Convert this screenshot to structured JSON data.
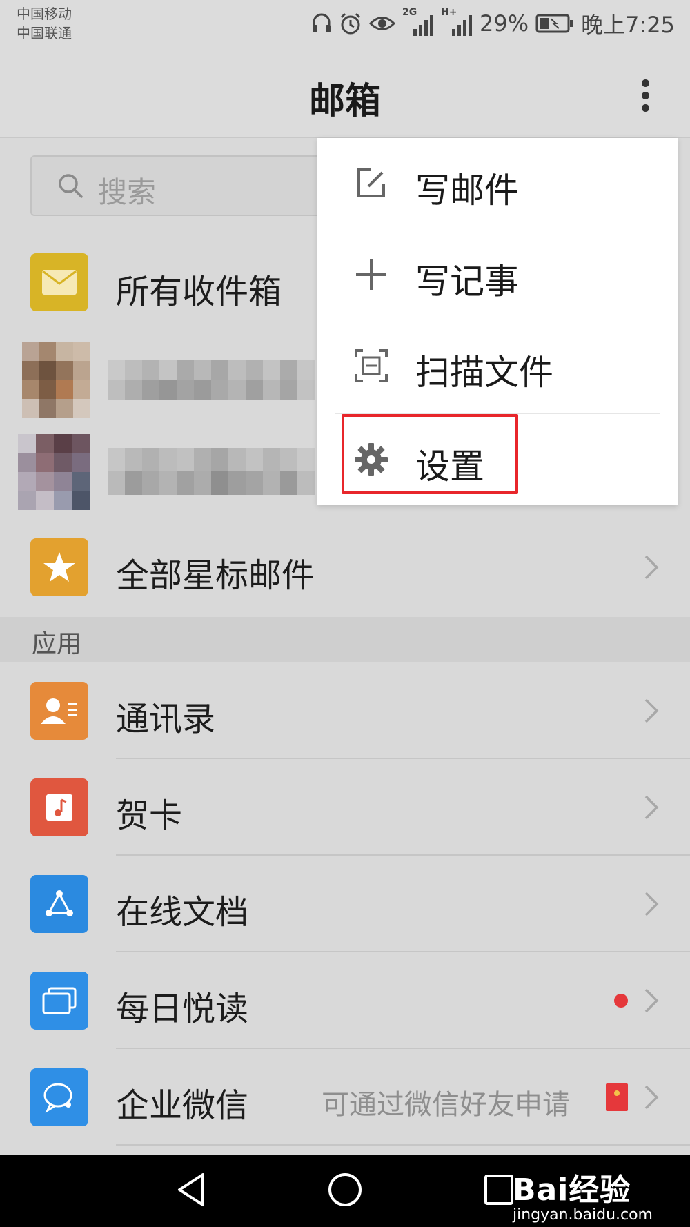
{
  "status_bar": {
    "carrier_1": "中国移动",
    "carrier_2": "中国联通",
    "signal_1": "2G",
    "signal_2": "H+",
    "battery": "29%",
    "time": "晚上7:25"
  },
  "header": {
    "title": "邮箱",
    "more_icon": "more-vertical-icon"
  },
  "search": {
    "placeholder": "搜索",
    "icon": "search-icon"
  },
  "mail_folders": [
    {
      "label": "所有收件箱",
      "icon": "envelope-icon",
      "color": "#d8b426"
    },
    {
      "label": "全部星标邮件",
      "icon": "star-icon",
      "color": "#e3a12f"
    }
  ],
  "section": {
    "title": "应用"
  },
  "apps": [
    {
      "label": "通讯录",
      "icon": "contacts-icon",
      "color": "#e68a3a"
    },
    {
      "label": "贺卡",
      "icon": "card-icon",
      "color": "#e0573f"
    },
    {
      "label": "在线文档",
      "icon": "document-icon",
      "color": "#2b8ae0"
    },
    {
      "label": "每日悦读",
      "icon": "reading-icon",
      "color": "#2f8fe6",
      "has_dot": true
    },
    {
      "label": "企业微信",
      "icon": "wework-icon",
      "color": "#2f8fe6",
      "hint": "可通过微信好友申请"
    }
  ],
  "menu": {
    "items": [
      {
        "label": "写邮件",
        "icon": "compose-icon"
      },
      {
        "label": "写记事",
        "icon": "plus-icon"
      },
      {
        "label": "扫描文件",
        "icon": "scan-icon"
      },
      {
        "label": "设置",
        "icon": "gear-icon"
      }
    ],
    "highlighted_item": "设置",
    "highlight_color": "#e8262b"
  },
  "watermark": {
    "brand": "Bai经验",
    "url": "jingyan.baidu.com"
  }
}
